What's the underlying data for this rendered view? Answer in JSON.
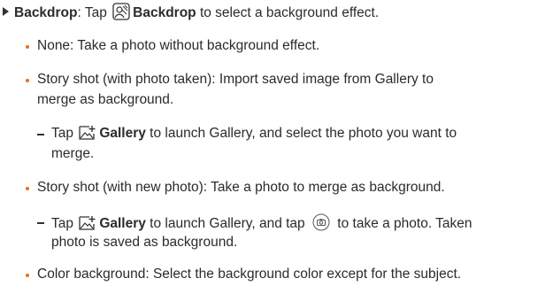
{
  "intro": {
    "term": "Backdrop",
    "sep": ": Tap ",
    "button": "Backdrop",
    "rest": " to select a background effect.",
    "icon": "backdrop-icon"
  },
  "items": {
    "none": "None: Take a photo without background effect.",
    "story_taken_l1": "Story shot (with photo taken): Import saved image from Gallery to",
    "story_taken_l2": "merge as background.",
    "story_taken_sub": {
      "pre": "Tap ",
      "button": "Gallery",
      "l1_rest": " to launch Gallery, and select the photo you want to",
      "l2": "merge."
    },
    "story_new": "Story shot (with new photo): Take a photo to merge as background.",
    "story_new_sub": {
      "pre": "Tap ",
      "button": "Gallery",
      "mid": " to launch Gallery, and tap ",
      "l1_end": " to take a photo. Taken",
      "l2": "photo is saved as background."
    },
    "color": "Color background: Select the background color except for the subject."
  },
  "colors": {
    "bullet": "#e8711c",
    "text": "#2b2b2b"
  },
  "icons": [
    "backdrop-icon",
    "gallery-add-icon",
    "camera-icon"
  ]
}
